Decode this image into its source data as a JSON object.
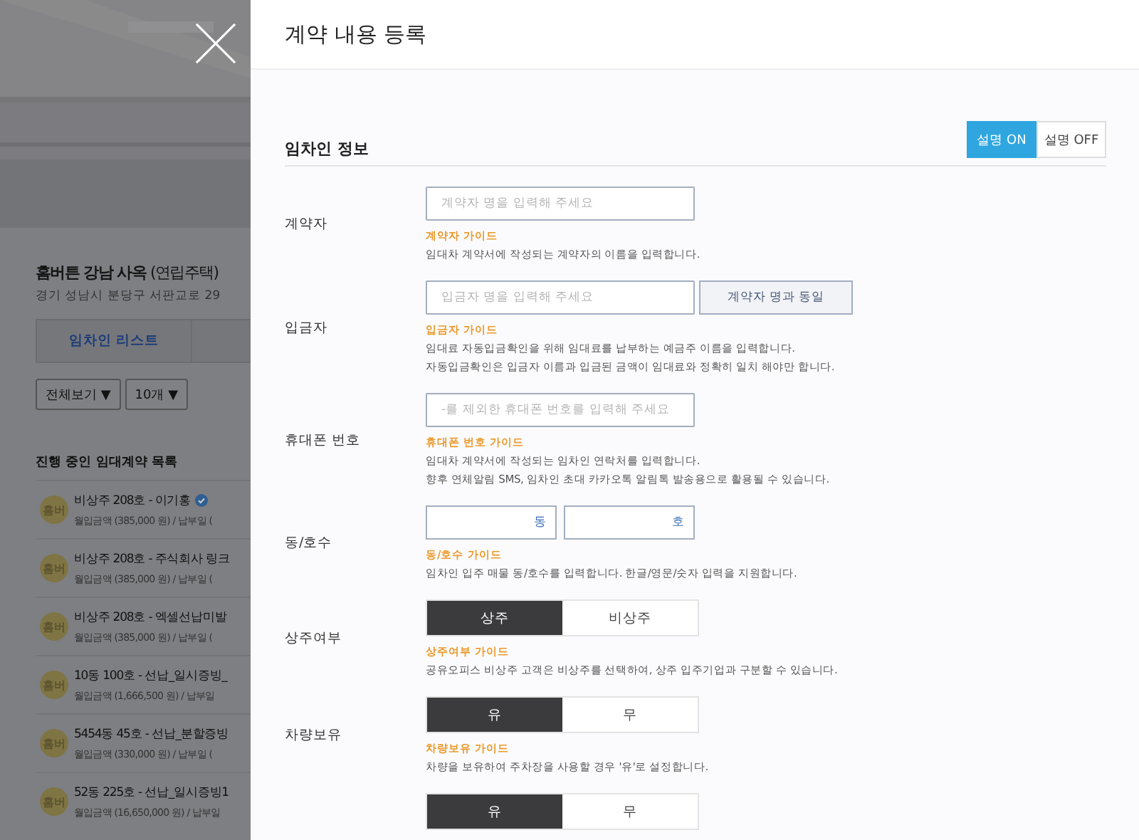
{
  "background_page": {
    "title": "홈버튼 강남 사옥",
    "title_suffix": "(연립주택)",
    "address": "경기 성남시 분당구 서판교로 29",
    "tabs": [
      {
        "label": "임차인 리스트",
        "selected": true
      }
    ],
    "filters": [
      "전체보기 ▼",
      "10개 ▼"
    ],
    "list_title": "진행 중인 임대계약 목록",
    "contracts": [
      {
        "avatar": "홈버",
        "name": "비상주 208호 - 이기홍",
        "verified": true,
        "detail": "월입금액 (385,000 원) / 납부일 ("
      },
      {
        "avatar": "홈버",
        "name": "비상주 208호 - 주식회사 링크",
        "verified": false,
        "detail": "월입금액 (385,000 원) / 납부일 ("
      },
      {
        "avatar": "홈버",
        "name": "비상주 208호 - 엑셀선납미발",
        "verified": false,
        "detail": "월입금액 (385,000 원) / 납부일 ("
      },
      {
        "avatar": "홈버",
        "name": "10동 100호 - 선납_일시증빙_",
        "verified": false,
        "detail": "월입금액 (1,666,500 원) / 납부일"
      },
      {
        "avatar": "홈버",
        "name": "5454동 45호 - 선납_분할증빙",
        "verified": false,
        "detail": "월입금액 (330,000 원) / 납부일 ("
      },
      {
        "avatar": "홈버",
        "name": "52동 225호 - 선납_일시증빙1",
        "verified": false,
        "detail": "월입금액 (16,650,000 원) / 납부일"
      }
    ]
  },
  "dialog": {
    "title": "계약 내용 등록",
    "help_toggle": [
      {
        "label": "설명 ON",
        "selected": true
      },
      {
        "label": "설명 OFF",
        "selected": false
      }
    ],
    "section_title": "임차인 정보",
    "fields": [
      {
        "kind": "text",
        "label": "계약자",
        "placeholder": "계약자 명을 입력해 주세요",
        "guide_title": "계약자 가이드",
        "guide": [
          "임대차 계약서에 작성되는 계약자의 이름을 입력합니다."
        ]
      },
      {
        "kind": "text",
        "label": "입금자",
        "placeholder": "입금자 명을 입력해 주세요",
        "button": "계약자 명과 동일",
        "guide_title": "입금자 가이드",
        "guide": [
          "임대료 자동입금확인을 위해 임대료를 납부하는 예금주 이름을 입력합니다.",
          "자동입금확인은 입금자 이름과 입금된 금액이 임대료와 정확히 일치 해야만 합니다."
        ]
      },
      {
        "kind": "text",
        "label": "휴대폰 번호",
        "placeholder": "-를 제외한 휴대폰 번호를 입력해 주세요",
        "guide_title": "휴대폰 번호 가이드",
        "guide": [
          "임대차 계약서에 작성되는 임차인 연락처를 입력합니다.",
          "향후 연체알림 SMS, 임차인 초대 카카오톡 알림톡 발송용으로 활용될 수 있습니다."
        ]
      },
      {
        "kind": "pair",
        "label": "동/호수",
        "units": [
          "동",
          "호"
        ],
        "guide_title": "동/호수 가이드",
        "guide": [
          "임차인 입주 매물 동/호수를 입력합니다. 한글/영문/숫자 입력을 지원합니다."
        ]
      },
      {
        "kind": "choice",
        "label": "상주여부",
        "options": [
          {
            "label": "상주",
            "selected": true
          },
          {
            "label": "비상주",
            "selected": false
          }
        ],
        "guide_title": "상주여부 가이드",
        "guide": [
          "공유오피스 비상주 고객은 비상주를 선택하여, 상주 입주기업과 구분할 수 있습니다."
        ]
      },
      {
        "kind": "choice",
        "label": "차량보유",
        "options": [
          {
            "label": "유",
            "selected": true
          },
          {
            "label": "무",
            "selected": false
          }
        ],
        "guide_title": "차량보유 가이드",
        "guide": [
          "차량을 보유하여 주차장을 사용할 경우 '유'로 설정합니다."
        ]
      },
      {
        "kind": "choice",
        "options": [
          {
            "label": "유",
            "selected": true
          },
          {
            "label": "무",
            "selected": false
          }
        ]
      }
    ]
  }
}
